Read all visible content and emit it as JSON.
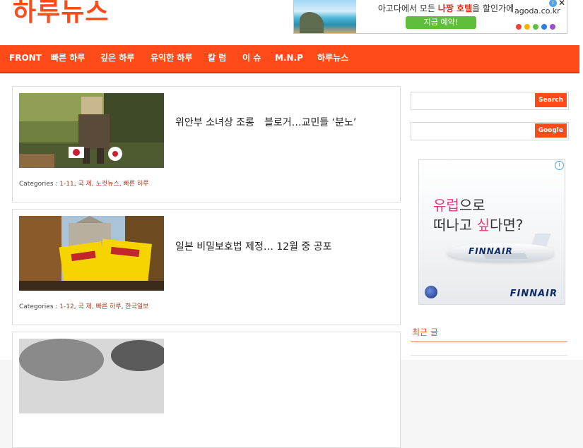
{
  "site": {
    "title": "하루뉴스"
  },
  "top_ad": {
    "message_before": "아고다에서 모든 ",
    "message_highlight": "나짱 호텔",
    "message_after": "을 할인가에",
    "button": "지금 예약!",
    "brand": "agoda.co.kr",
    "dot_colors": [
      "#e8453c",
      "#f4b400",
      "#5fbf3c",
      "#2f7de0",
      "#9b4fcf"
    ]
  },
  "nav": {
    "items": [
      "FRONT",
      "빠른 하루",
      "깊은 하루",
      "유익한 하루",
      "칼 럼",
      "이 슈",
      "M.N.P",
      "하루뉴스"
    ]
  },
  "posts": [
    {
      "title": "위안부 소녀상 조롱　블로거…교민들 ‘분노’",
      "categories_label": "Categories :",
      "categories": [
        "1-11",
        "국 제",
        "노컷뉴스",
        "빠른 하루"
      ]
    },
    {
      "title": "일본 비밀보호법 제정… 12월 중 공포",
      "categories_label": "Categories :",
      "categories": [
        "1-12",
        "국 제",
        "빠른 하루",
        "한국일보"
      ]
    }
  ],
  "sidebar": {
    "search_button": "Search",
    "google_button": "Google",
    "ad": {
      "line1_pink": "유럽",
      "line1_rest": "으로",
      "line2_a": "떠나고 ",
      "line2_pink": "싶",
      "line2_b": "다면?",
      "plane_text": "FINNAIR",
      "logo": "FINNAIR"
    },
    "recent_heading": "최근 글"
  },
  "colors": {
    "accent": "#ff4a1a",
    "link": "#a04028"
  }
}
